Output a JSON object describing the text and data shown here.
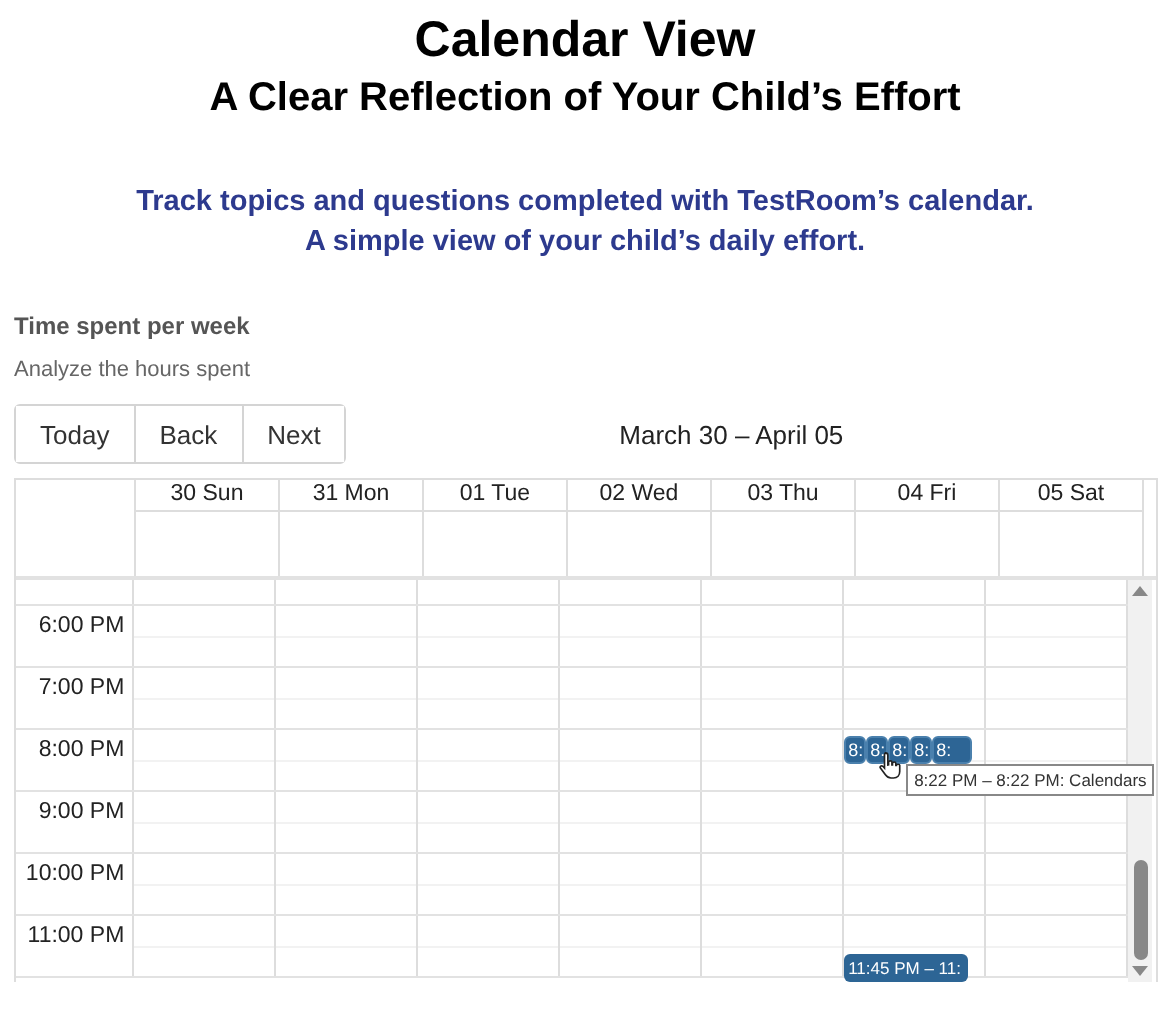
{
  "heading": {
    "title": "Calendar View",
    "subtitle": "A Clear Reflection of Your Child’s Effort"
  },
  "intro": [
    "Track topics and questions completed with TestRoom’s calendar.",
    "A simple view of your child’s daily effort."
  ],
  "panel": {
    "title": "Time spent per week",
    "subtitle": "Analyze the hours spent"
  },
  "toolbar": {
    "buttons": [
      "Today",
      "Back",
      "Next"
    ],
    "range": "March 30 – April 05"
  },
  "days": [
    "30 Sun",
    "31 Mon",
    "01 Tue",
    "02 Wed",
    "03 Thu",
    "04 Fri",
    "05 Sat"
  ],
  "hours": [
    {
      "label": "6:00 PM",
      "cells": [
        {},
        {},
        {},
        {},
        {},
        {},
        {}
      ]
    },
    {
      "label": "7:00 PM",
      "cells": [
        {},
        {},
        {},
        {},
        {},
        {},
        {}
      ]
    },
    {
      "label": "8:00 PM",
      "cells": [
        {},
        {},
        {},
        {},
        {},
        {
          "first_half": [
            {
              "label": "8:",
              "hovered": false
            },
            {
              "label": "8:",
              "hovered": true,
              "tooltip": "8:22 PM – 8:22 PM: Calendars"
            },
            {
              "label": "8:",
              "hovered": false
            },
            {
              "label": "8:",
              "hovered": false
            },
            {
              "label": "8:",
              "hovered": false
            }
          ]
        },
        {}
      ]
    },
    {
      "label": "9:00 PM",
      "cells": [
        {},
        {},
        {},
        {},
        {},
        {},
        {}
      ]
    },
    {
      "label": "10:00 PM",
      "cells": [
        {},
        {},
        {},
        {},
        {},
        {},
        {}
      ]
    },
    {
      "label": "11:00 PM",
      "cells": [
        {},
        {},
        {},
        {},
        {},
        {
          "second_half": [
            {
              "label": "11:45 PM – 11:",
              "hovered": false
            }
          ]
        },
        {}
      ]
    }
  ]
}
